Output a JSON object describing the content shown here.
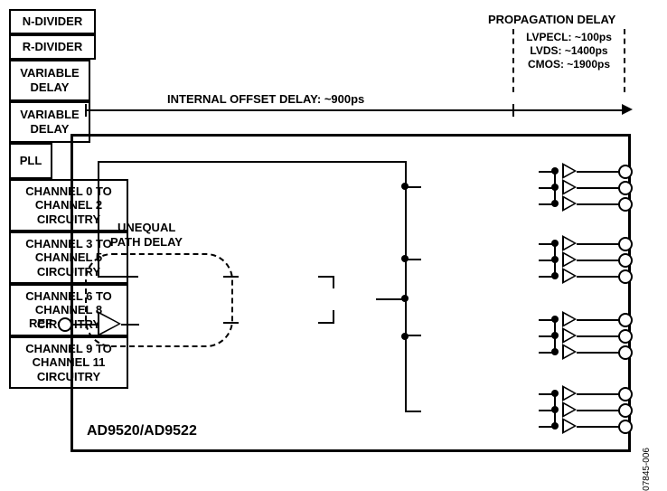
{
  "header": {
    "prop_title": "PROPAGATION DELAY",
    "lvpecl": "LVPECL: ~100ps",
    "lvds": "LVDS: ~1400ps",
    "cmos": "CMOS: ~1900ps",
    "offset": "INTERNAL OFFSET DELAY: ~900ps"
  },
  "labels": {
    "ref": "REF",
    "unequal1": "UNEQUAL",
    "unequal2": "PATH DELAY",
    "ndiv": "N-DIVIDER",
    "rdiv": "R-DIVIDER",
    "vdelay": "VARIABLE\nDELAY",
    "pll": "PLL",
    "part": "AD9520/AD9522",
    "fig": "07845-006"
  },
  "channels": [
    "CHANNEL 0 TO\nCHANNEL 2\nCIRCUITRY",
    "CHANNEL 3 TO\nCHANNEL 5\nCIRCUITRY",
    "CHANNEL 6 TO\nCHANNEL 8\nCIRCUITRY",
    "CHANNEL 9 TO\nCHANNEL 11\nCIRCUITRY"
  ]
}
